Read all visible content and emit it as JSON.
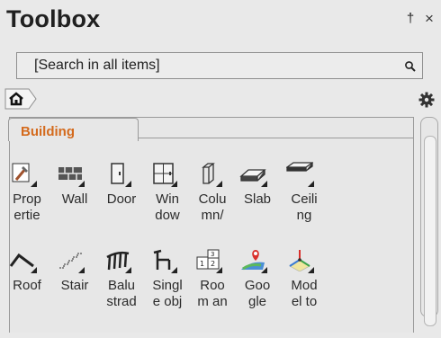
{
  "panel": {
    "title": "Toolbox",
    "pin_icon": "pin-icon",
    "close_icon": "close-icon",
    "pin_glyph": "†",
    "close_glyph": "×"
  },
  "search": {
    "placeholder": "[Search in all items]",
    "icon": "search-icon"
  },
  "breadcrumb": {
    "home_icon": "home-icon"
  },
  "settings": {
    "icon": "gear-icon"
  },
  "tab": {
    "label": "Building"
  },
  "accent_color": "#d46a1c",
  "tools_row1": [
    {
      "label": "Prop\nertie",
      "icon": "properties-icon"
    },
    {
      "label": "Wall",
      "icon": "wall-icon"
    },
    {
      "label": "Door",
      "icon": "door-icon"
    },
    {
      "label": "Win\ndow",
      "icon": "window-icon"
    },
    {
      "label": "Colu\nmn/",
      "icon": "column-icon"
    },
    {
      "label": "Slab",
      "icon": "slab-icon"
    },
    {
      "label": "Ceili\nng",
      "icon": "ceiling-icon"
    }
  ],
  "tools_row2": [
    {
      "label": "Roof",
      "icon": "roof-icon"
    },
    {
      "label": "Stair",
      "icon": "stair-icon"
    },
    {
      "label": "Balu\nstrad",
      "icon": "balustrade-icon"
    },
    {
      "label": "Singl\ne obj",
      "icon": "single-object-icon"
    },
    {
      "label": "Roo\nm an",
      "icon": "room-icon"
    },
    {
      "label": "Goo\ngle",
      "icon": "google-earth-icon"
    },
    {
      "label": "Mod\nel to",
      "icon": "model-axes-icon"
    }
  ]
}
